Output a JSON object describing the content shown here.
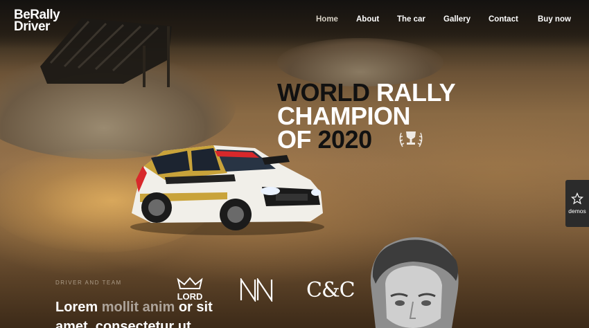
{
  "brand": {
    "line1": "BeRally",
    "line2": "Driver"
  },
  "nav": {
    "items": [
      {
        "label": "Home",
        "active": true
      },
      {
        "label": "About",
        "active": false
      },
      {
        "label": "The car",
        "active": false
      },
      {
        "label": "Gallery",
        "active": false
      },
      {
        "label": "Contact",
        "active": false
      },
      {
        "label": "Buy now",
        "active": false
      }
    ]
  },
  "hero": {
    "line1_a": "WORLD",
    "line1_b": "RALLY",
    "line2": "CHAMPION",
    "line3_a": "OF",
    "line3_b": "2020",
    "icon": "trophy-laurel-icon"
  },
  "demos": {
    "label": "demos",
    "icon": "star-icon"
  },
  "partners": {
    "label": "DRIVER AND TEAM",
    "lord": "LORD",
    "cc": "C&C",
    "nn_icon": "nn-logo-icon"
  },
  "intro": {
    "line1_a": "Lorem",
    "line1_b": "mollit anim",
    "line1_c": "or sit",
    "line2": "amet, consectetur ut"
  },
  "colors": {
    "headline_dark": "#111111",
    "headline_light": "#ffffff",
    "demos_bg": "#2b2b2b"
  }
}
